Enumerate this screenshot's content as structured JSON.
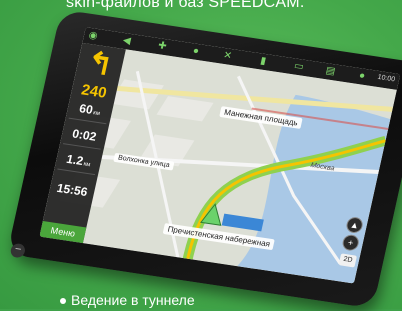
{
  "page": {
    "caption_top": "skin-файлов и баз SPEEDCAM.",
    "caption_bottom": "Ведение в туннеле"
  },
  "device": {
    "status_time": "10:00",
    "left_panel": {
      "turn_icon": "turn-left-arrow",
      "speed": "240",
      "distance_value": "60",
      "distance_unit": "км",
      "time_value": "0:02",
      "remain_value": "1.2",
      "remain_unit": "км",
      "arrival_value": "15:56",
      "menu_label": "Меню"
    },
    "map": {
      "street_top": "Манежная площадь",
      "street_left": "Волхонка улица",
      "street_bottom": "Пречистенская набережная",
      "city_label": "Москва",
      "view_mode": "2D"
    }
  },
  "colors": {
    "background": "#3fa24a",
    "accent_yellow": "#f5c400",
    "route_green": "#8fd14f",
    "menu_green": "#4aa63b"
  }
}
